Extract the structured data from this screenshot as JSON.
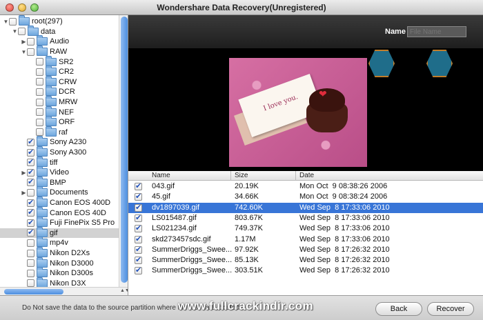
{
  "window": {
    "title": "Wondershare Data Recovery(Unregistered)"
  },
  "sidebar": {
    "items": [
      {
        "label": "root(297)",
        "indent": 0,
        "expanded": true,
        "checked": false
      },
      {
        "label": "data",
        "indent": 1,
        "expanded": true,
        "checked": false
      },
      {
        "label": "Audio",
        "indent": 2,
        "expanded": false,
        "hasChildren": true,
        "checked": false
      },
      {
        "label": "RAW",
        "indent": 2,
        "expanded": true,
        "checked": false
      },
      {
        "label": "SR2",
        "indent": 3,
        "checked": false
      },
      {
        "label": "CR2",
        "indent": 3,
        "checked": false
      },
      {
        "label": "CRW",
        "indent": 3,
        "checked": false
      },
      {
        "label": "DCR",
        "indent": 3,
        "checked": false
      },
      {
        "label": "MRW",
        "indent": 3,
        "checked": false
      },
      {
        "label": "NEF",
        "indent": 3,
        "checked": false
      },
      {
        "label": "ORF",
        "indent": 3,
        "checked": false
      },
      {
        "label": "raf",
        "indent": 3,
        "checked": false
      },
      {
        "label": "Sony A230",
        "indent": 2,
        "checked": true
      },
      {
        "label": "Sony A300",
        "indent": 2,
        "checked": true
      },
      {
        "label": "tiff",
        "indent": 2,
        "checked": true
      },
      {
        "label": "Video",
        "indent": 2,
        "hasChildren": true,
        "checked": true
      },
      {
        "label": "BMP",
        "indent": 2,
        "checked": true
      },
      {
        "label": "Documents",
        "indent": 2,
        "hasChildren": true,
        "checked": false
      },
      {
        "label": "Canon EOS 400D",
        "indent": 2,
        "checked": true
      },
      {
        "label": "Canon EOS 40D",
        "indent": 2,
        "checked": true
      },
      {
        "label": "Fuji FinePix S5 Pro",
        "indent": 2,
        "checked": true
      },
      {
        "label": "gif",
        "indent": 2,
        "checked": true,
        "selected": true
      },
      {
        "label": "mp4v",
        "indent": 2,
        "checked": false
      },
      {
        "label": "Nikon D2Xs",
        "indent": 2,
        "checked": false
      },
      {
        "label": "Nikon D3000",
        "indent": 2,
        "checked": false
      },
      {
        "label": "Nikon D300s",
        "indent": 2,
        "checked": false
      },
      {
        "label": "Nikon D3X",
        "indent": 2,
        "checked": false
      }
    ]
  },
  "preview": {
    "name_label": "Name",
    "name_placeholder": "File Name",
    "card_text": "I love you."
  },
  "table": {
    "columns": [
      "Name",
      "Size",
      "Date"
    ],
    "rows": [
      {
        "name": "043.gif",
        "size": "20.19K",
        "date": "Mon Oct  9 08:38:26 2006",
        "checked": true,
        "selected": false
      },
      {
        "name": "45.gif",
        "size": "34.66K",
        "date": "Mon Oct  9 08:38:24 2006",
        "checked": true,
        "selected": false
      },
      {
        "name": "dv1897039.gif",
        "size": "742.60K",
        "date": "Wed Sep  8 17:33:06 2010",
        "checked": true,
        "selected": true
      },
      {
        "name": "LS015487.gif",
        "size": "803.67K",
        "date": "Wed Sep  8 17:33:06 2010",
        "checked": true,
        "selected": false
      },
      {
        "name": "LS021234.gif",
        "size": "749.37K",
        "date": "Wed Sep  8 17:33:06 2010",
        "checked": true,
        "selected": false
      },
      {
        "name": "skd273457sdc.gif",
        "size": "1.17M",
        "date": "Wed Sep  8 17:33:06 2010",
        "checked": true,
        "selected": false
      },
      {
        "name": "SummerDriggs_Swee...",
        "size": "97.92K",
        "date": "Wed Sep  8 17:26:32 2010",
        "checked": true,
        "selected": false
      },
      {
        "name": "SummerDriggs_Swee...",
        "size": "85.13K",
        "date": "Wed Sep  8 17:26:32 2010",
        "checked": true,
        "selected": false
      },
      {
        "name": "SummerDriggs_Swee...",
        "size": "303.51K",
        "date": "Wed Sep  8 17:26:32 2010",
        "checked": true,
        "selected": false
      }
    ]
  },
  "footer": {
    "status": "Do Not save the data to the source partition where the lost data located.",
    "back_label": "Back",
    "recover_label": "Recover",
    "watermark": "www.fullcrackindir.com"
  }
}
